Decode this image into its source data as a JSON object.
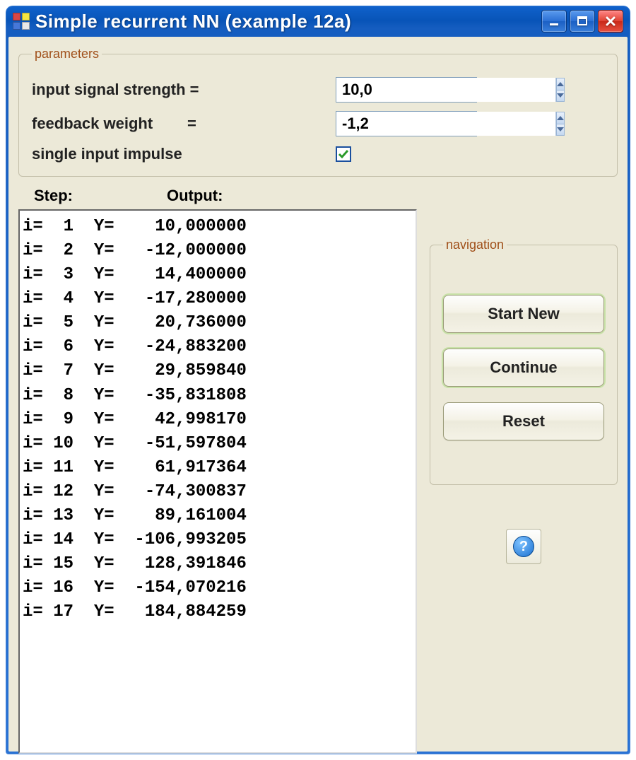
{
  "window": {
    "title": "Simple recurrent NN (example 12a)"
  },
  "parameters": {
    "legend": "parameters",
    "input_signal_label": "input signal strength =",
    "input_signal_value": "10,0",
    "feedback_label": "feedback weight        =",
    "feedback_value": "-1,2",
    "single_impulse_label": "single input impulse",
    "single_impulse_checked": true
  },
  "headers": {
    "step": "Step:",
    "output": "Output:"
  },
  "rows": [
    {
      "i": 1,
      "y": "10,000000"
    },
    {
      "i": 2,
      "y": "-12,000000"
    },
    {
      "i": 3,
      "y": "14,400000"
    },
    {
      "i": 4,
      "y": "-17,280000"
    },
    {
      "i": 5,
      "y": "20,736000"
    },
    {
      "i": 6,
      "y": "-24,883200"
    },
    {
      "i": 7,
      "y": "29,859840"
    },
    {
      "i": 8,
      "y": "-35,831808"
    },
    {
      "i": 9,
      "y": "42,998170"
    },
    {
      "i": 10,
      "y": "-51,597804"
    },
    {
      "i": 11,
      "y": "61,917364"
    },
    {
      "i": 12,
      "y": "-74,300837"
    },
    {
      "i": 13,
      "y": "89,161004"
    },
    {
      "i": 14,
      "y": "-106,993205"
    },
    {
      "i": 15,
      "y": "128,391846"
    },
    {
      "i": 16,
      "y": "-154,070216"
    },
    {
      "i": 17,
      "y": "184,884259"
    }
  ],
  "navigation": {
    "legend": "navigation",
    "start_new": "Start New",
    "continue": "Continue",
    "reset": "Reset"
  },
  "help": {
    "glyph": "?"
  }
}
